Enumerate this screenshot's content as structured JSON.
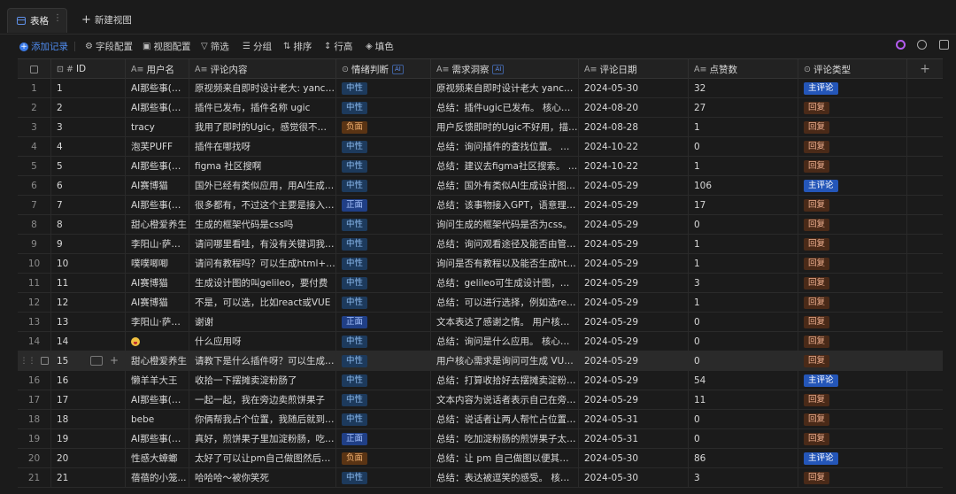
{
  "tabs": {
    "active": "表格",
    "more": "⋮",
    "new_view": "新建视图"
  },
  "toolbar": {
    "add_record": "添加记录",
    "field_config": "字段配置",
    "view_config": "视图配置",
    "filter": "筛选",
    "group": "分组",
    "sort": "排序",
    "row_height": "行高",
    "fill_color": "填色"
  },
  "columns": {
    "id": "ID",
    "username": "用户名",
    "comment": "评论内容",
    "sentiment": "情绪判断",
    "insight": "需求洞察",
    "date": "评论日期",
    "likes": "点赞数",
    "type": "评论类型",
    "ai_badge": "AI"
  },
  "colors": {
    "neutral_bg": "#1d3a5c",
    "neutral_fg": "#8ab8ec",
    "negative_bg": "#5a3414",
    "negative_fg": "#f0b070",
    "positive_bg": "#203f86",
    "positive_fg": "#a8c4ff",
    "main_bg": "#2456b8",
    "main_fg": "#ffffff",
    "reply_bg": "#4a2a18",
    "reply_fg": "#f0b090"
  },
  "rows": [
    {
      "idx": "1",
      "id": "1",
      "user": "AI那些事(搞...",
      "comment": "原视频来自即时设计老大: yancy...",
      "sentiment": "中性",
      "insight": "原视频来自即时设计老大 yancymi...",
      "date": "2024-05-30",
      "likes": "32",
      "type": "主评论"
    },
    {
      "idx": "2",
      "id": "2",
      "user": "AI那些事(搞...",
      "comment": "插件已发布，插件名称 ugic",
      "sentiment": "中性",
      "insight": "总结：插件ugic已发布。 核心需求...",
      "date": "2024-08-20",
      "likes": "27",
      "type": "回复"
    },
    {
      "idx": "3",
      "id": "3",
      "user": "tracy",
      "comment": "我用了即时的Ugic，感觉很不好用...",
      "sentiment": "负面",
      "insight": "用户反馈即时的Ugic不好用，描述...",
      "date": "2024-08-28",
      "likes": "1",
      "type": "回复"
    },
    {
      "idx": "4",
      "id": "4",
      "user": "泡芙PUFF",
      "comment": "插件在哪找呀",
      "sentiment": "中性",
      "insight": "总结：询问插件的查找位置。 核...",
      "date": "2024-10-22",
      "likes": "0",
      "type": "回复"
    },
    {
      "idx": "5",
      "id": "5",
      "user": "AI那些事(搞...",
      "comment": "figma 社区搜啊",
      "sentiment": "中性",
      "insight": "总结：建议去figma社区搜索。 核...",
      "date": "2024-10-22",
      "likes": "1",
      "type": "回复"
    },
    {
      "idx": "6",
      "id": "6",
      "user": "AI赛博猫",
      "comment": "国外已经有类似应用，用AI生成设...",
      "sentiment": "中性",
      "insight": "总结：国外有类似AI生成设计图...",
      "date": "2024-05-29",
      "likes": "106",
      "type": "主评论"
    },
    {
      "idx": "7",
      "id": "7",
      "user": "AI那些事(搞...",
      "comment": "很多都有，不过这个主要是接入了...",
      "sentiment": "正面",
      "insight": "总结：该事物接入GPT，语意理解...",
      "date": "2024-05-29",
      "likes": "17",
      "type": "回复"
    },
    {
      "idx": "8",
      "id": "8",
      "user": "甜心橙爱养生",
      "comment": "生成的框架代码是css吗",
      "sentiment": "中性",
      "insight": "询问生成的框架代码是否为css。",
      "date": "2024-05-29",
      "likes": "0",
      "type": "回复"
    },
    {
      "idx": "9",
      "id": "9",
      "user": "李阳山·萨提...",
      "comment": "请问哪里看哇，有没有关键词我去...",
      "sentiment": "中性",
      "insight": "总结：询问观看途径及能否由管理...",
      "date": "2024-05-29",
      "likes": "1",
      "type": "回复"
    },
    {
      "idx": "10",
      "id": "10",
      "user": "噗噗唧唧",
      "comment": "请问有教程吗？可以生成html+css...",
      "sentiment": "中性",
      "insight": "询问是否有教程以及能否生成html...",
      "date": "2024-05-29",
      "likes": "1",
      "type": "回复"
    },
    {
      "idx": "11",
      "id": "11",
      "user": "AI赛博猫",
      "comment": "生成设计图的叫gelileo，要付费",
      "sentiment": "中性",
      "insight": "总结：gelileo可生成设计图，使用...",
      "date": "2024-05-29",
      "likes": "3",
      "type": "回复"
    },
    {
      "idx": "12",
      "id": "12",
      "user": "AI赛博猫",
      "comment": "不是，可以选，比如react或VUE",
      "sentiment": "中性",
      "insight": "总结：可以进行选择，例如选react...",
      "date": "2024-05-29",
      "likes": "1",
      "type": "回复"
    },
    {
      "idx": "13",
      "id": "13",
      "user": "李阳山·萨提...",
      "comment": "谢谢",
      "sentiment": "正面",
      "insight": "文本表达了感谢之情。 用户核心...",
      "date": "2024-05-29",
      "likes": "0",
      "type": "回复"
    },
    {
      "idx": "14",
      "id": "14",
      "user": "",
      "emoji": true,
      "comment": "什么应用呀",
      "sentiment": "中性",
      "insight": "总结：询问是什么应用。 核心需...",
      "date": "2024-05-29",
      "likes": "0",
      "type": "回复"
    },
    {
      "idx": "",
      "id": "15",
      "user": "甜心橙爱养生",
      "comment": "请教下是什么插件呀？可以生成V...",
      "sentiment": "中性",
      "insight": "用户核心需求是询问可生成 VUE ...",
      "date": "2024-05-29",
      "likes": "0",
      "type": "回复",
      "hover": true
    },
    {
      "idx": "16",
      "id": "16",
      "user": "懒羊羊大王",
      "comment": "收拾一下摆摊卖淀粉肠了",
      "sentiment": "中性",
      "insight": "总结：打算收拾好去摆摊卖淀粉肠...",
      "date": "2024-05-29",
      "likes": "54",
      "type": "主评论"
    },
    {
      "idx": "17",
      "id": "17",
      "user": "AI那些事(搞...",
      "comment": "一起一起，我在旁边卖煎饼果子",
      "sentiment": "中性",
      "insight": "文本内容为说话者表示自己在旁边...",
      "date": "2024-05-29",
      "likes": "11",
      "type": "回复"
    },
    {
      "idx": "18",
      "id": "18",
      "user": "bebe",
      "comment": "你俩帮我占个位置，我随后就到，...",
      "sentiment": "中性",
      "insight": "总结：说话者让两人帮忙占位置，...",
      "date": "2024-05-31",
      "likes": "0",
      "type": "回复"
    },
    {
      "idx": "19",
      "id": "19",
      "user": "AI那些事(搞...",
      "comment": "真好，煎饼果子里加淀粉肠，吃煎...",
      "sentiment": "正面",
      "insight": "总结：吃加淀粉肠的煎饼果子太干...",
      "date": "2024-05-31",
      "likes": "0",
      "type": "回复"
    },
    {
      "idx": "20",
      "id": "20",
      "user": "性感大蟑螂",
      "comment": "太好了可以让pm自己做图然后发...",
      "sentiment": "负面",
      "insight": "总结：让 pm 自己做图以便其发现...",
      "date": "2024-05-30",
      "likes": "86",
      "type": "主评论"
    },
    {
      "idx": "21",
      "id": "21",
      "user": "蓓蓓的小笼...",
      "comment": "哈哈哈～被你笑死",
      "sentiment": "中性",
      "insight": "总结：表达被逗笑的感受。 核心需...",
      "date": "2024-05-30",
      "likes": "3",
      "type": "回复"
    }
  ]
}
